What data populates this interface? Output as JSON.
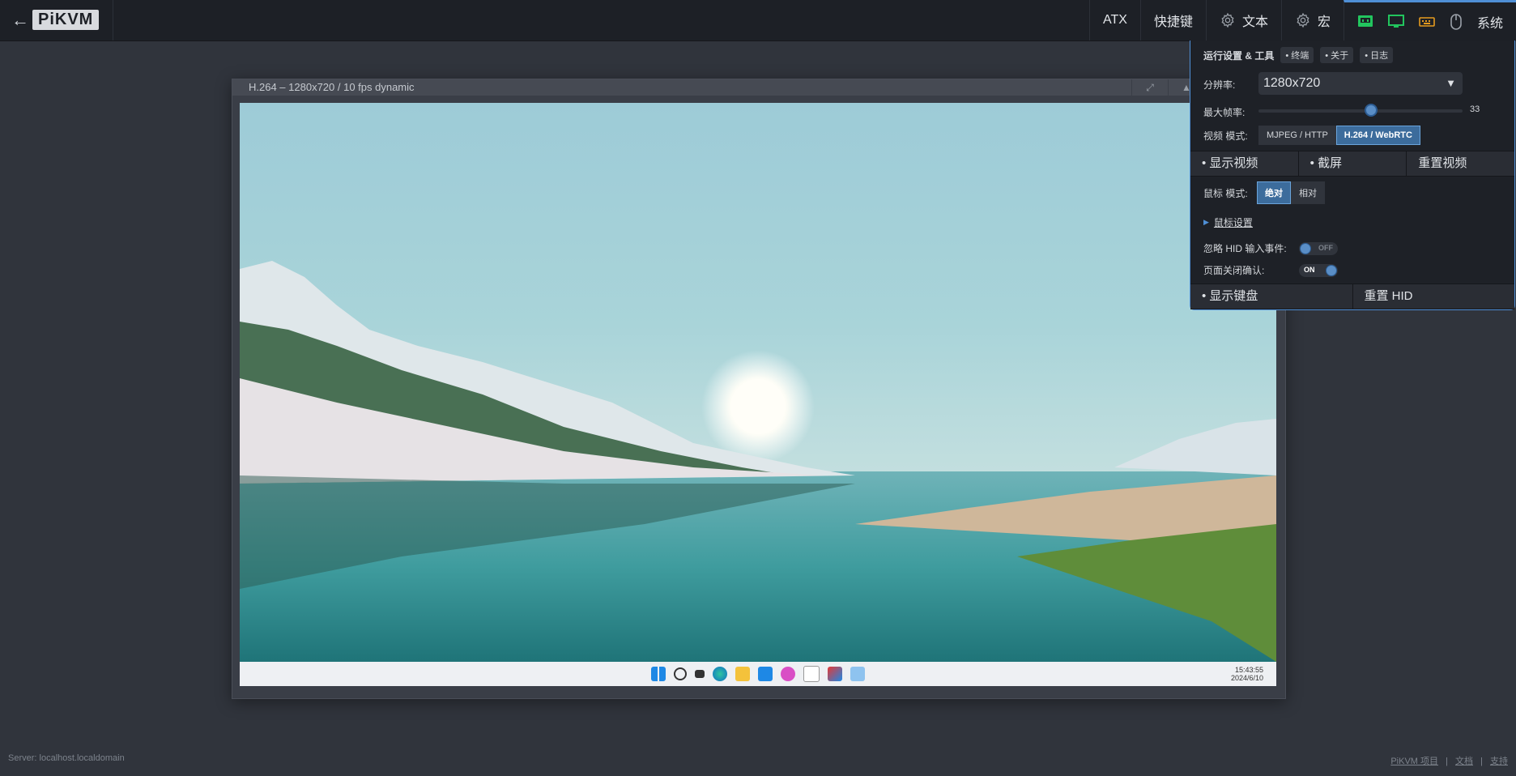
{
  "topbar": {
    "back_arrow": "←",
    "logo": "PiKVM",
    "menu": {
      "atx": "ATX",
      "shortcuts": "快捷键",
      "text": "文本",
      "macro": "宏",
      "system": "系统"
    }
  },
  "stream": {
    "title": "H.264 – 1280x720 / 10 fps dynamic",
    "clock_time": "15:43:55",
    "clock_date": "2024/6/10"
  },
  "panel": {
    "header": "运行设置 & 工具",
    "chips": [
      "• 终端",
      "• 关于",
      "• 日志"
    ],
    "resolution_label": "分辨率:",
    "resolution_value": "1280x720",
    "framerate_label": "最大帧率:",
    "framerate_value": "33",
    "framerate_fraction": 0.55,
    "video_mode_label": "视频 模式:",
    "video_modes": [
      "MJPEG / HTTP",
      "H.264 / WebRTC"
    ],
    "video_actions": [
      "• 显示视频",
      "• 截屏",
      "重置视频"
    ],
    "mouse_mode_label": "鼠标 模式:",
    "mouse_modes": [
      "绝对",
      "相对"
    ],
    "mouse_settings": "鼠标设置",
    "ignore_hid_label": "忽略 HID 输入事件:",
    "ignore_hid_state": "OFF",
    "page_close_label": "页面关闭确认:",
    "page_close_state": "ON",
    "bottom_actions": [
      "• 显示键盘",
      "重置 HID"
    ]
  },
  "footer": {
    "server": "Server: localhost.localdomain",
    "links": [
      "PiKVM 项目",
      "文档",
      "支持"
    ],
    "sep": "|"
  },
  "colors": {
    "accent": "#4f8fd6",
    "bg": "#30343c",
    "indicator_green": "#22c55e",
    "indicator_orange": "#e59a1e"
  },
  "icons": [
    "back-arrow-icon",
    "gear-icon",
    "network-icon",
    "monitor-icon",
    "keyboard-icon",
    "mouse-icon"
  ]
}
